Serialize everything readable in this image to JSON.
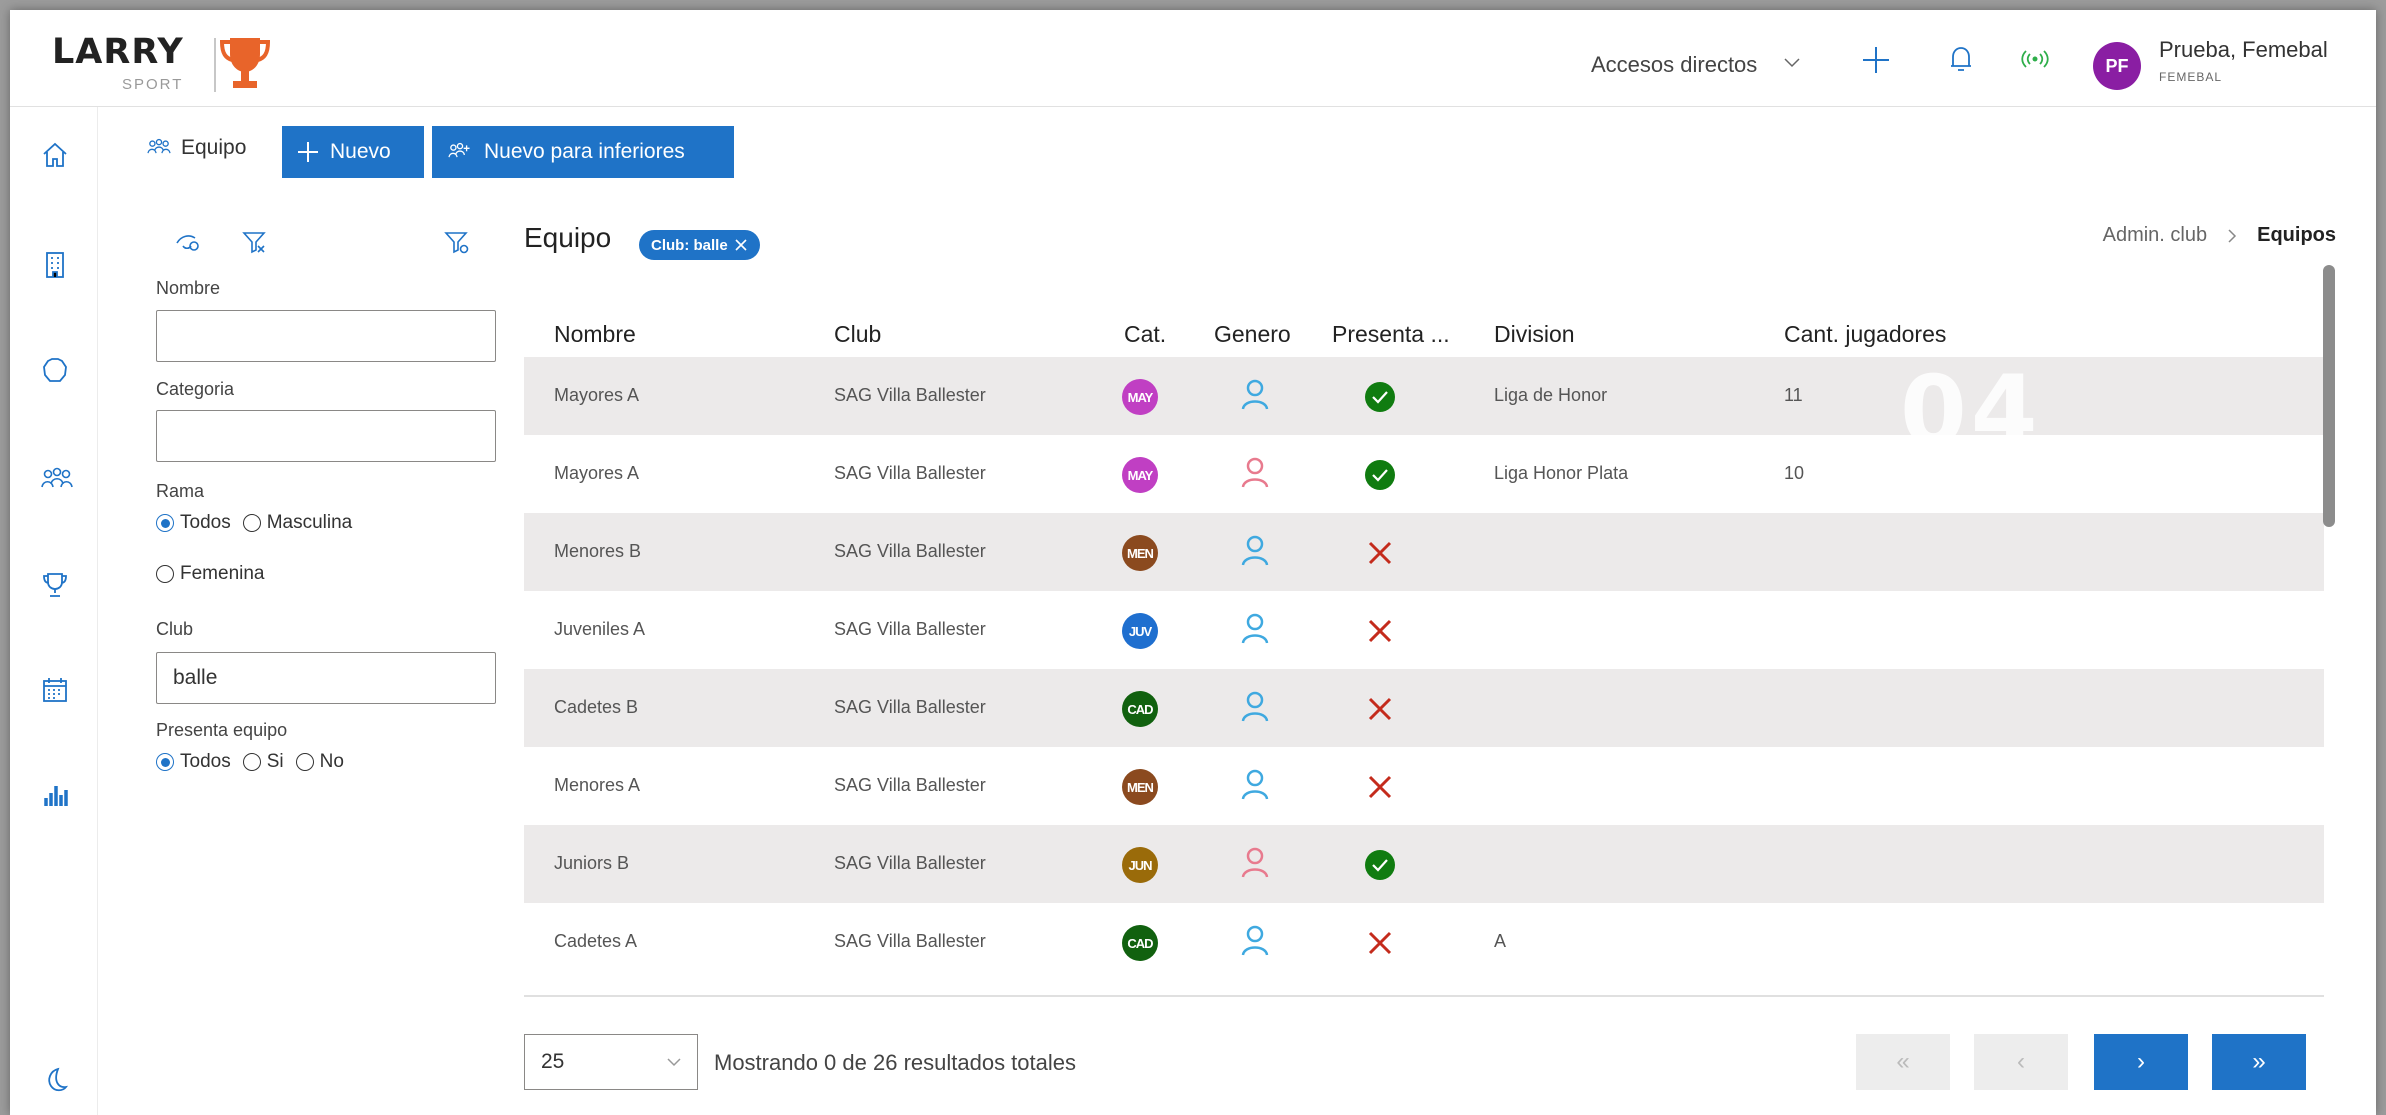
{
  "app": {
    "logo_text": "LARRY",
    "logo_sub": "SPORT"
  },
  "topbar": {
    "accesos_label": "Accesos directos",
    "user_initials": "PF",
    "user_name": "Prueba, Femebal",
    "user_org": "FEMEBAL"
  },
  "sidebar": {
    "items": [
      {
        "icon": "home-icon"
      },
      {
        "icon": "building-icon"
      },
      {
        "icon": "ball-icon"
      },
      {
        "icon": "team-icon"
      },
      {
        "icon": "trophy-icon"
      },
      {
        "icon": "calendar-icon"
      },
      {
        "icon": "chart-icon"
      },
      {
        "icon": "moon-icon"
      }
    ]
  },
  "commandbar": {
    "title": "Equipo",
    "new_label": "Nuevo",
    "new_lower_label": "Nuevo para inferiores"
  },
  "filters": {
    "nombre_label": "Nombre",
    "nombre_value": "",
    "categoria_label": "Categoria",
    "categoria_value": "",
    "rama_label": "Rama",
    "rama_options": [
      "Todos",
      "Masculina",
      "Femenina"
    ],
    "rama_selected": "Todos",
    "club_label": "Club",
    "club_value": "balle",
    "presenta_label": "Presenta equipo",
    "presenta_options": [
      "Todos",
      "Si",
      "No"
    ],
    "presenta_selected": "Todos"
  },
  "main": {
    "title": "Equipo",
    "chip": "Club: balle",
    "breadcrumb": [
      "Admin. club",
      "Equipos"
    ],
    "watermark": "04"
  },
  "table": {
    "columns": [
      "Nombre",
      "Club",
      "Cat.",
      "Genero",
      "Presenta ...",
      "Division",
      "Cant. jugadores"
    ],
    "rows": [
      {
        "nombre": "Mayores A",
        "club": "SAG Villa Ballester",
        "cat": "MAY",
        "cat_color": "#c03fc3",
        "genero": "masculino",
        "presenta": true,
        "division": "Liga de Honor",
        "cant": "11"
      },
      {
        "nombre": "Mayores A",
        "club": "SAG Villa Ballester",
        "cat": "MAY",
        "cat_color": "#c03fc3",
        "genero": "femenino",
        "presenta": true,
        "division": "Liga Honor Plata",
        "cant": "10"
      },
      {
        "nombre": "Menores B",
        "club": "SAG Villa Ballester",
        "cat": "MEN",
        "cat_color": "#8b4a1f",
        "genero": "masculino",
        "presenta": false,
        "division": "",
        "cant": ""
      },
      {
        "nombre": "Juveniles A",
        "club": "SAG Villa Ballester",
        "cat": "JUV",
        "cat_color": "#1f6fcf",
        "genero": "masculino",
        "presenta": false,
        "division": "",
        "cant": ""
      },
      {
        "nombre": "Cadetes B",
        "club": "SAG Villa Ballester",
        "cat": "CAD",
        "cat_color": "#11610f",
        "genero": "masculino",
        "presenta": false,
        "division": "",
        "cant": ""
      },
      {
        "nombre": "Menores A",
        "club": "SAG Villa Ballester",
        "cat": "MEN",
        "cat_color": "#8b4a1f",
        "genero": "masculino",
        "presenta": false,
        "division": "",
        "cant": ""
      },
      {
        "nombre": "Juniors B",
        "club": "SAG Villa Ballester",
        "cat": "JUN",
        "cat_color": "#9a6b0a",
        "genero": "femenino",
        "presenta": true,
        "division": "",
        "cant": ""
      },
      {
        "nombre": "Cadetes A",
        "club": "SAG Villa Ballester",
        "cat": "CAD",
        "cat_color": "#11610f",
        "genero": "masculino",
        "presenta": false,
        "division": "A",
        "cant": ""
      }
    ]
  },
  "pager": {
    "page_size": "25",
    "status": "Mostrando 0 de 26 resultados totales",
    "first": "«",
    "prev": "‹",
    "next": "›",
    "last": "»"
  },
  "colors": {
    "accent": "#1f73c7",
    "male": "#3fa9e0",
    "female": "#e87a8e",
    "ok": "#107c10",
    "no": "#c42b1c"
  }
}
